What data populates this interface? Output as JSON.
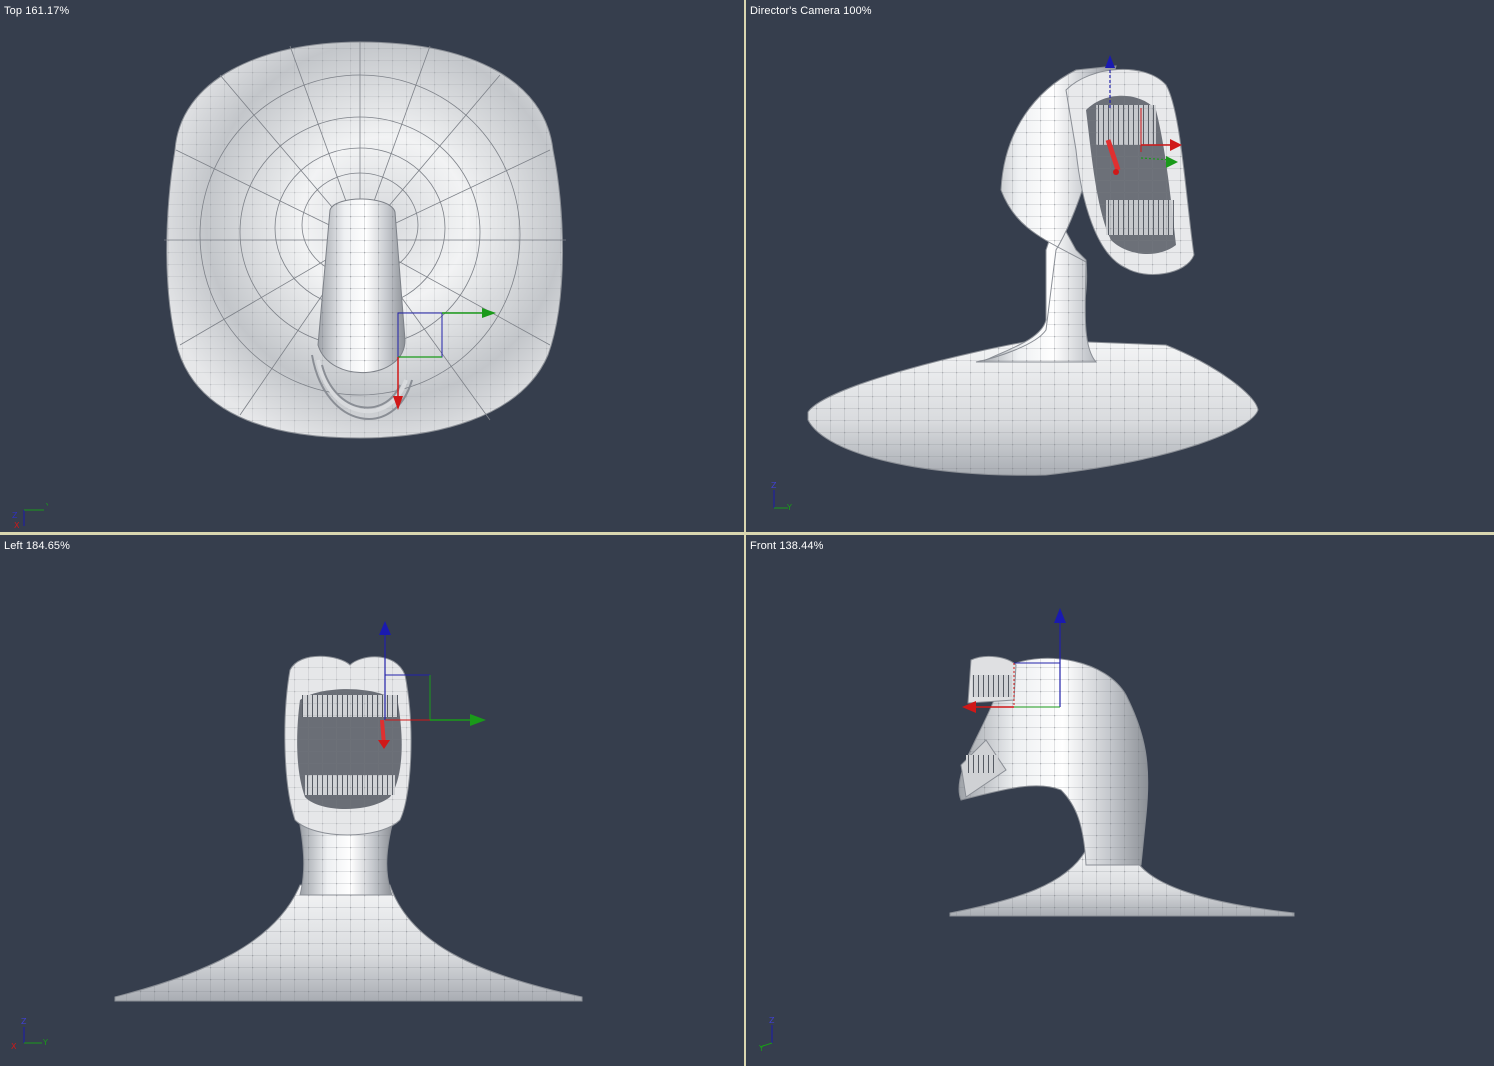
{
  "viewports": {
    "top": {
      "label": "Top 161.17%"
    },
    "camera": {
      "label": "Director's Camera 100%"
    },
    "left": {
      "label": "Left 184.65%"
    },
    "front": {
      "label": "Front 138.44%"
    }
  },
  "axis_colors": {
    "x": "#d01818",
    "y": "#1a9a1a",
    "z": "#1a1ab0"
  },
  "background_color": "#363e4d",
  "border_color": "#d9d6b0",
  "triads": {
    "top": {
      "h": "Y",
      "v": "Z",
      "corner": "X"
    },
    "camera": {
      "h": "Y",
      "v": "Z"
    },
    "left": {
      "h": "Y",
      "v": "Z",
      "corner": "X"
    },
    "front": {
      "h": "Y",
      "v": "Z"
    }
  }
}
